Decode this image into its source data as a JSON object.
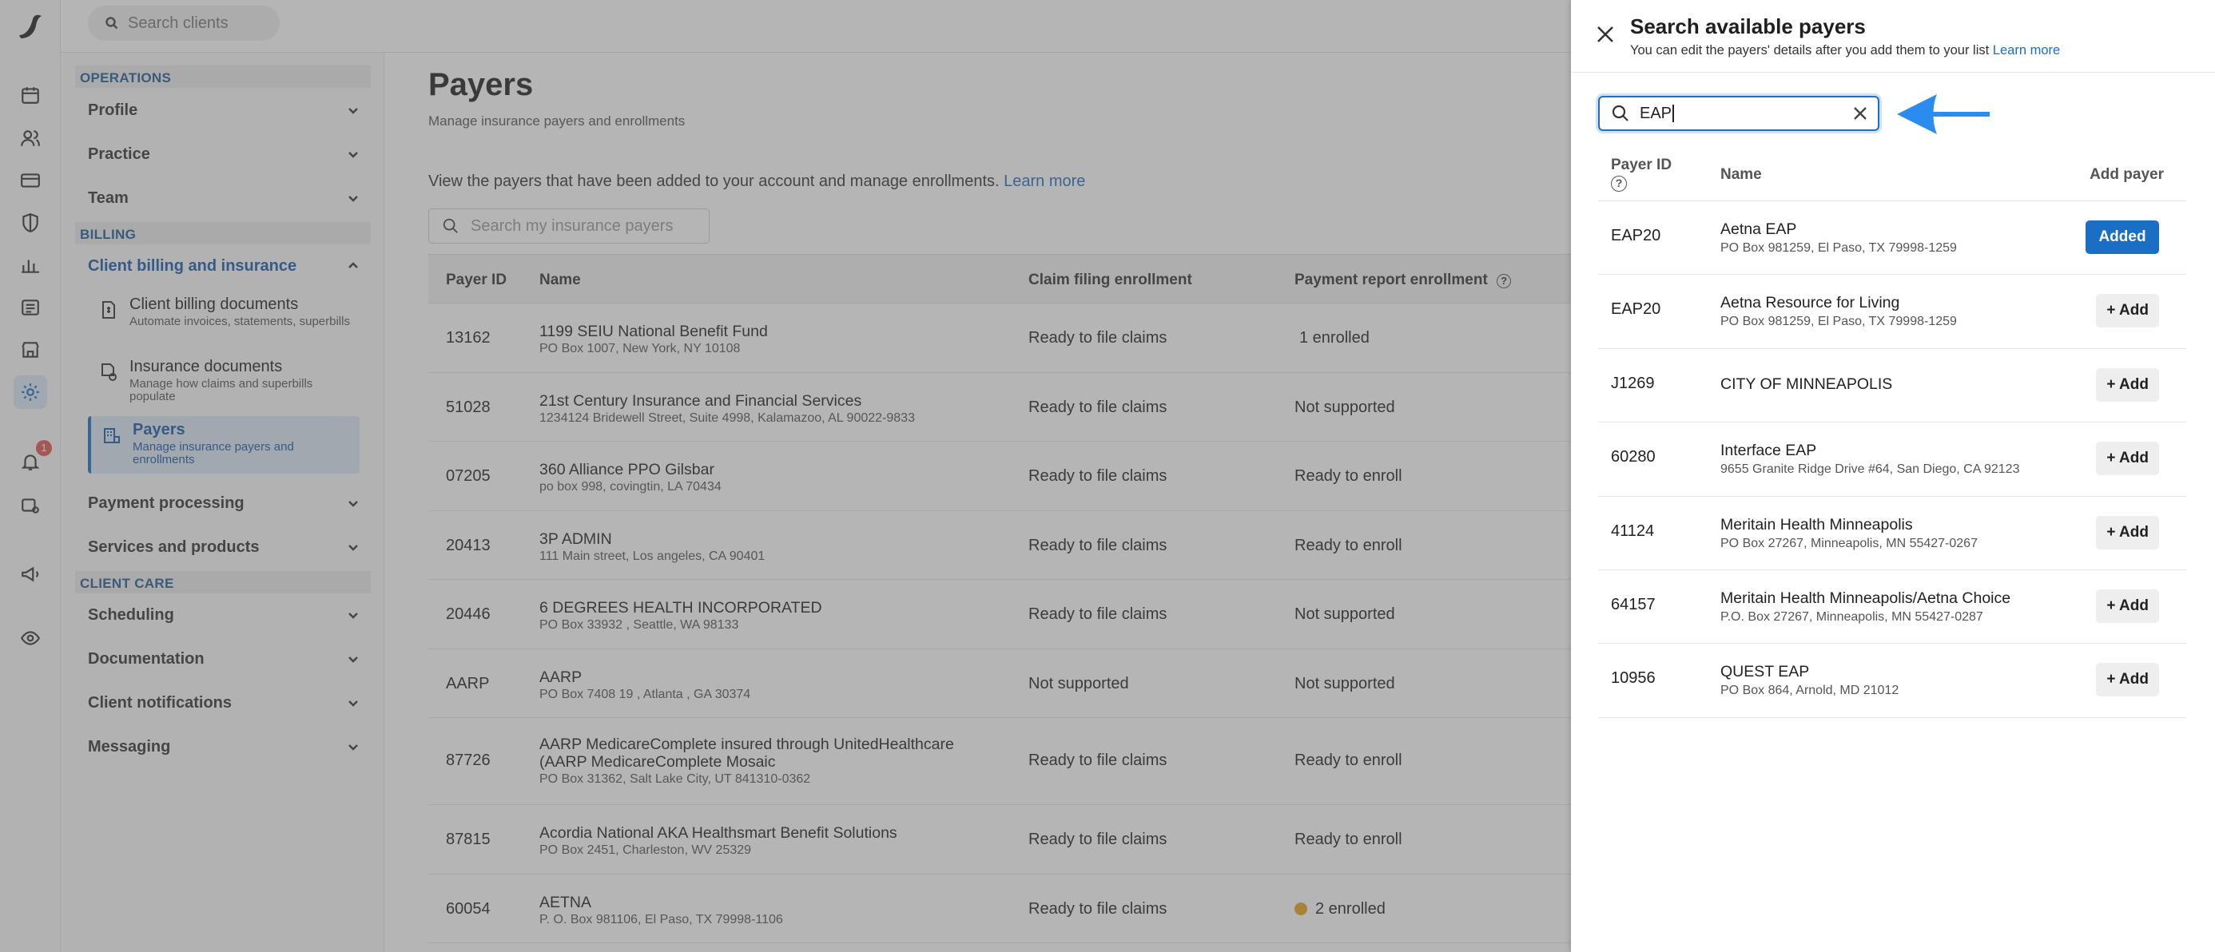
{
  "topbar": {
    "search_placeholder": "Search clients"
  },
  "nav": {
    "sections": {
      "operations": "OPERATIONS",
      "billing": "BILLING",
      "client_care": "CLIENT CARE"
    },
    "items": {
      "profile": "Profile",
      "practice": "Practice",
      "team": "Team",
      "client_billing": "Client billing and insurance",
      "payment_processing": "Payment processing",
      "services_products": "Services and products",
      "scheduling": "Scheduling",
      "documentation": "Documentation",
      "client_notifications": "Client notifications",
      "messaging": "Messaging"
    },
    "sub_items": [
      {
        "title": "Client billing documents",
        "desc": "Automate invoices, statements, superbills"
      },
      {
        "title": "Insurance documents",
        "desc": "Manage how claims and superbills populate"
      },
      {
        "title": "Payers",
        "desc": "Manage insurance payers and enrollments"
      }
    ],
    "notification_count": "1"
  },
  "main": {
    "title": "Payers",
    "subtitle": "Manage insurance payers and enrollments",
    "intro": "View the payers that have been added to your account and manage enrollments.",
    "intro_link": "Learn more",
    "search_placeholder": "Search my insurance payers",
    "columns": {
      "id": "Payer ID",
      "name": "Name",
      "claim": "Claim filing enrollment",
      "payment": "Payment report enrollment"
    },
    "rows": [
      {
        "id": "13162",
        "name": "1199 SEIU National Benefit Fund",
        "address": "PO Box 1007, New York, NY 10108",
        "claim": "Ready to file claims",
        "payment": "1 enrolled"
      },
      {
        "id": "51028",
        "name": "21st Century Insurance and Financial Services",
        "address": "1234124 Bridewell Street, Suite 4998, Kalamazoo, AL 90022-9833",
        "claim": "Ready to file claims",
        "payment": "Not supported"
      },
      {
        "id": "07205",
        "name": "360 Alliance PPO Gilsbar",
        "address": "po box 998, covingtin, LA 70434",
        "claim": "Ready to file claims",
        "payment": "Ready to enroll"
      },
      {
        "id": "20413",
        "name": "3P ADMIN",
        "address": "111 Main street, Los angeles, CA 90401",
        "claim": "Ready to file claims",
        "payment": "Ready to enroll"
      },
      {
        "id": "20446",
        "name": "6 DEGREES HEALTH INCORPORATED",
        "address": "PO Box 33932 , Seattle, WA 98133",
        "claim": "Ready to file claims",
        "payment": "Not supported"
      },
      {
        "id": "AARP",
        "name": "AARP",
        "address": "PO Box 7408 19 , Atlanta , GA 30374",
        "claim": "Not supported",
        "payment": "Not supported"
      },
      {
        "id": "87726",
        "name": "AARP MedicareComplete insured through UnitedHealthcare (AARP MedicareComplete Mosaic",
        "address": "PO Box 31362, Salt Lake City, UT 841310-0362",
        "claim": "Ready to file claims",
        "payment": "Ready to enroll"
      },
      {
        "id": "87815",
        "name": "Acordia National AKA Healthsmart Benefit Solutions",
        "address": "PO Box 2451, Charleston, WV 25329",
        "claim": "Ready to file claims",
        "payment": "Ready to enroll"
      },
      {
        "id": "60054",
        "name": "AETNA",
        "address": "P. O. Box 981106, El Paso, TX 79998-1106",
        "claim": "Ready to file claims",
        "payment": "2 enrolled"
      }
    ]
  },
  "drawer": {
    "title": "Search available payers",
    "subtitle": "You can edit the payers' details after you add them to your list",
    "subtitle_link": "Learn more",
    "search_value": "EAP",
    "columns": {
      "id": "Payer ID",
      "name": "Name",
      "add": "Add payer"
    },
    "results": [
      {
        "id": "EAP20",
        "name": "Aetna EAP",
        "address": "PO Box 981259, El Paso, TX 79998-1259",
        "action": "Added"
      },
      {
        "id": "EAP20",
        "name": "Aetna Resource for Living",
        "address": "PO Box 981259, El Paso, TX 79998-1259",
        "action": "+ Add"
      },
      {
        "id": "J1269",
        "name": "CITY OF MINNEAPOLIS",
        "address": "",
        "action": "+ Add"
      },
      {
        "id": "60280",
        "name": "Interface EAP",
        "address": "9655 Granite Ridge Drive #64, San Diego, CA 92123",
        "action": "+ Add"
      },
      {
        "id": "41124",
        "name": "Meritain Health Minneapolis",
        "address": "PO Box 27267, Minneapolis, MN 55427-0267",
        "action": "+ Add"
      },
      {
        "id": "64157",
        "name": "Meritain Health Minneapolis/Aetna Choice",
        "address": "P.O. Box 27267, Minneapolis, MN 55427-0287",
        "action": "+ Add"
      },
      {
        "id": "10956",
        "name": "QUEST EAP",
        "address": "PO Box 864, Arnold, MD 21012",
        "action": "+ Add"
      }
    ]
  },
  "colors": {
    "accent": "#1a6fc4",
    "arrow": "#2b8cf0",
    "warning_dot": "#e8a21c",
    "badge": "#e0544f"
  }
}
